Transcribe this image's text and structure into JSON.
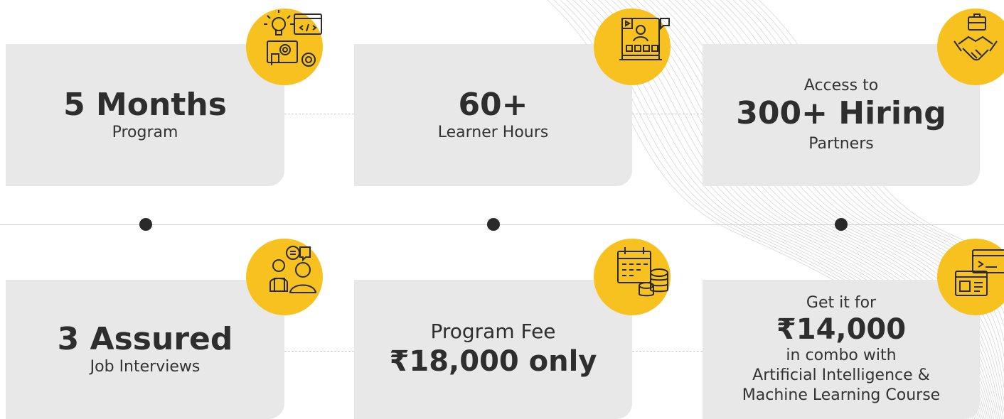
{
  "colors": {
    "accent": "#f7c21f",
    "card": "#e8e8e8",
    "text": "#2e2e2e",
    "dot": "#2a2a2a"
  },
  "cards": [
    {
      "title": "5 Months",
      "subtitle": "Program",
      "icon": "coding-settings-icon"
    },
    {
      "title": "60+",
      "subtitle": "Learner Hours",
      "icon": "online-learning-icon"
    },
    {
      "pre": "Access to",
      "title": "300+ Hiring",
      "subtitle": "Partners",
      "icon": "handshake-briefcase-icon"
    },
    {
      "title": "3 Assured",
      "subtitle": "Job Interviews",
      "icon": "interview-chat-icon"
    },
    {
      "pre": "Program Fee",
      "title": "₹18,000 only",
      "icon": "calendar-coins-icon"
    },
    {
      "pre": "Get it for",
      "title": "₹14,000",
      "lines": [
        "in combo with",
        "Artificial Intelligence &",
        "Machine Learning Course"
      ],
      "icon": "course-windows-icon"
    }
  ]
}
